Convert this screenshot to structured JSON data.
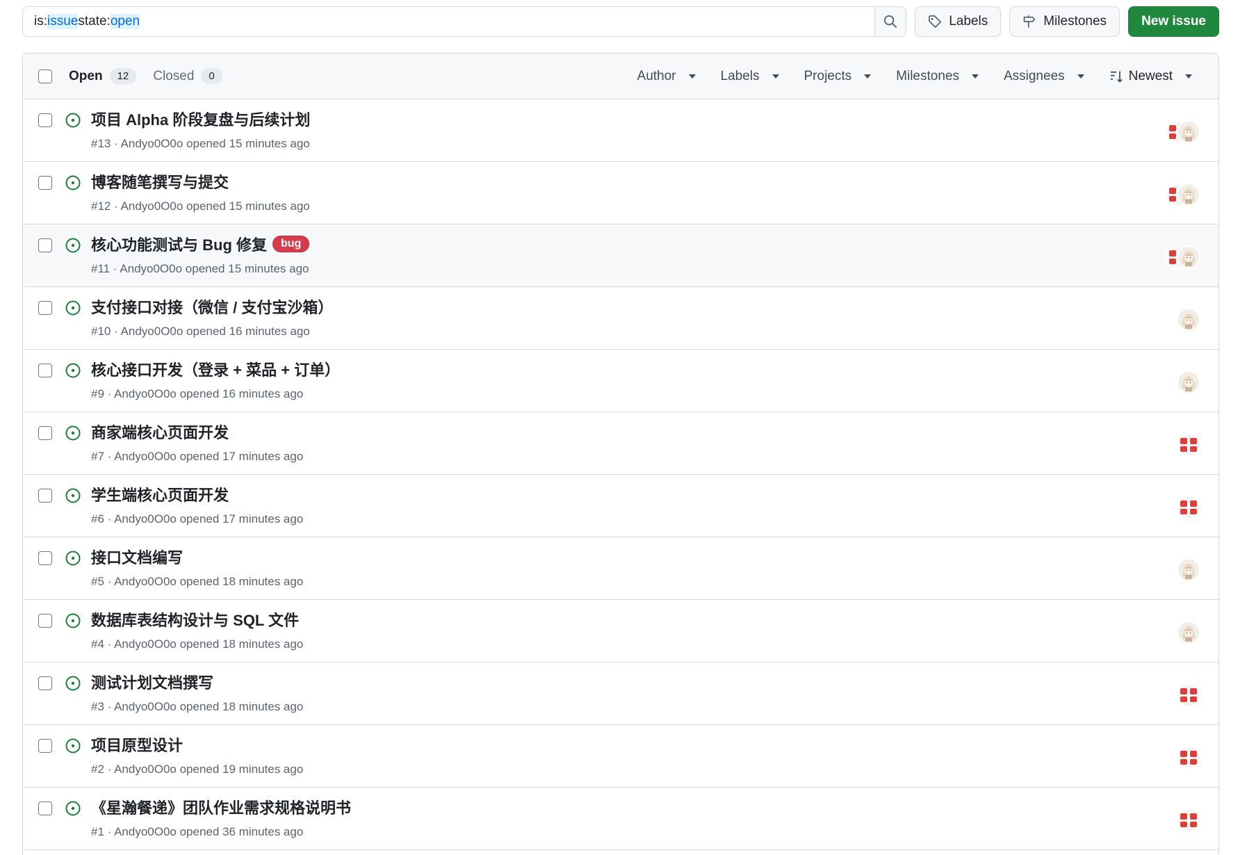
{
  "search": {
    "parts": [
      "is:",
      "issue",
      " state:",
      "open"
    ]
  },
  "toolbar": {
    "labels_label": "Labels",
    "milestones_label": "Milestones",
    "new_issue_label": "New issue"
  },
  "header": {
    "open_label": "Open",
    "open_count": "12",
    "closed_label": "Closed",
    "closed_count": "0",
    "filters": [
      "Author",
      "Labels",
      "Projects",
      "Milestones",
      "Assignees"
    ],
    "sort_label": "Newest"
  },
  "colors": {
    "open_icon": "#1a7f37",
    "new_issue_bg": "#1f883d",
    "bug_label": "#d73a4a"
  },
  "issues": [
    {
      "title": "项目 Alpha 阶段复盘与后续计划",
      "meta": "#13 · Andyo0O0o opened 15 minutes ago",
      "label": "",
      "assignees": [
        "red-pattern-avatar",
        "anime-girl-avatar"
      ]
    },
    {
      "title": "博客随笔撰写与提交",
      "meta": "#12 · Andyo0O0o opened 15 minutes ago",
      "label": "",
      "assignees": [
        "red-pattern-avatar",
        "anime-girl-avatar"
      ]
    },
    {
      "title": "核心功能测试与 Bug 修复",
      "meta": "#11 · Andyo0O0o opened 15 minutes ago",
      "label": "bug",
      "assignees": [
        "red-pattern-avatar",
        "anime-girl-avatar"
      ]
    },
    {
      "title": "支付接口对接（微信 / 支付宝沙箱）",
      "meta": "#10 · Andyo0O0o opened 16 minutes ago",
      "label": "",
      "assignees": [
        "anime-girl-avatar"
      ]
    },
    {
      "title": "核心接口开发（登录 + 菜品 + 订单）",
      "meta": "#9 · Andyo0O0o opened 16 minutes ago",
      "label": "",
      "assignees": [
        "anime-girl-avatar"
      ]
    },
    {
      "title": "商家端核心页面开发",
      "meta": "#7 · Andyo0O0o opened 17 minutes ago",
      "label": "",
      "assignees": [
        "red-pattern-avatar"
      ]
    },
    {
      "title": "学生端核心页面开发",
      "meta": "#6 · Andyo0O0o opened 17 minutes ago",
      "label": "",
      "assignees": [
        "red-pattern-avatar"
      ]
    },
    {
      "title": "接口文档编写",
      "meta": "#5 · Andyo0O0o opened 18 minutes ago",
      "label": "",
      "assignees": [
        "anime-girl-avatar"
      ]
    },
    {
      "title": "数据库表结构设计与 SQL 文件",
      "meta": "#4 · Andyo0O0o opened 18 minutes ago",
      "label": "",
      "assignees": [
        "anime-girl-avatar"
      ]
    },
    {
      "title": "测试计划文档撰写",
      "meta": "#3 · Andyo0O0o opened 18 minutes ago",
      "label": "",
      "assignees": [
        "red-pattern-avatar"
      ]
    },
    {
      "title": "项目原型设计",
      "meta": "#2 · Andyo0O0o opened 19 minutes ago",
      "label": "",
      "assignees": [
        "red-pattern-avatar"
      ]
    },
    {
      "title": "《星瀚餐递》团队作业需求规格说明书",
      "meta": "#1 · Andyo0O0o opened 36 minutes ago",
      "label": "",
      "assignees": [
        "red-pattern-avatar"
      ]
    }
  ]
}
